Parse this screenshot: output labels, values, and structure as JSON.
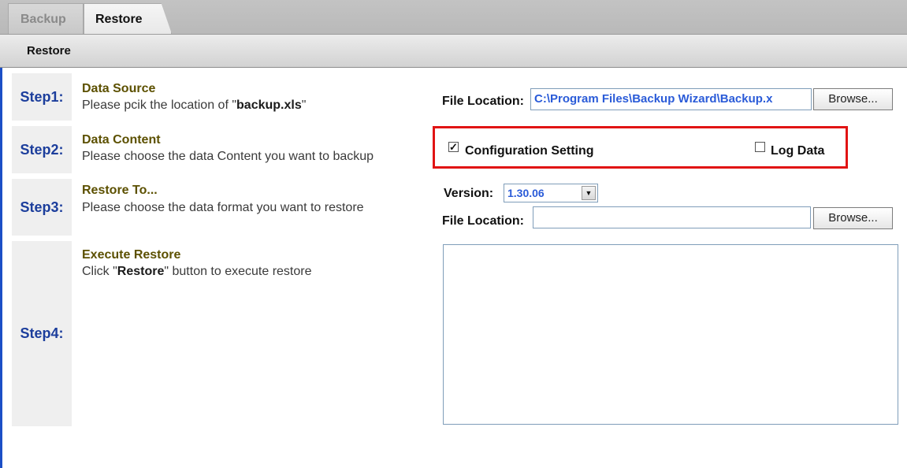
{
  "tabs": {
    "backup": "Backup",
    "restore": "Restore"
  },
  "toolbar": {
    "title": "Restore"
  },
  "steps": [
    {
      "label": "Step1:",
      "title": "Data Source",
      "desc_pre": "Please pcik the location of \"",
      "desc_bold": "backup.xls",
      "desc_post": "\""
    },
    {
      "label": "Step2:",
      "title": "Data Content",
      "desc": "Please choose the data Content you want to backup"
    },
    {
      "label": "Step3:",
      "title": "Restore To...",
      "desc": "Please choose the data format you want to restore"
    },
    {
      "label": "Step4:",
      "title": "Execute Restore",
      "desc_pre": "Click \"",
      "desc_bold": "Restore",
      "desc_post": "\" button to execute restore"
    }
  ],
  "source": {
    "file_location_label": "File Location:",
    "file_location_value": "C:\\Program Files\\Backup Wizard\\Backup.x",
    "browse_label": "Browse..."
  },
  "content": {
    "config_label": "Configuration Setting",
    "config_checked": true,
    "log_label": "Log Data",
    "log_checked": false
  },
  "restore_to": {
    "version_label": "Version:",
    "version_value": "1.30.06",
    "file_location_label": "File Location:",
    "file_location_value": "",
    "browse_label": "Browse..."
  },
  "colors": {
    "step_label": "#1c3e9c",
    "highlight": "#e11414",
    "input_text": "#2a5bd8"
  }
}
